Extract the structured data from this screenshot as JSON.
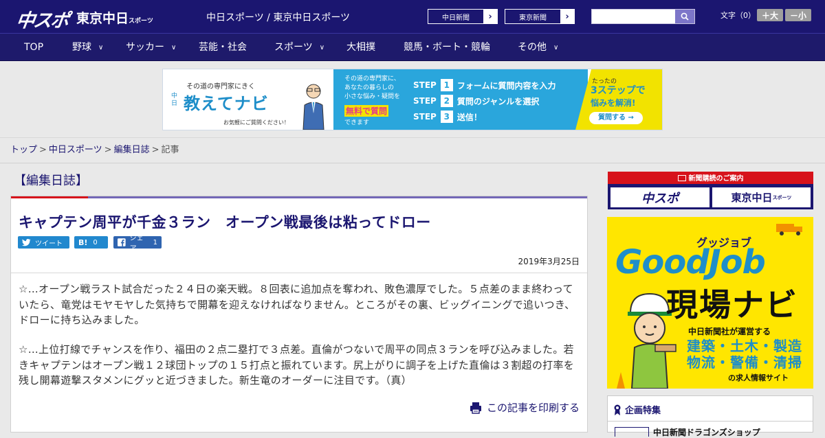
{
  "header": {
    "logo_main": "中スポ",
    "logo_sub": "東京中日",
    "logo_sub_small": "スポーツ",
    "tagline": "中日スポーツ / 東京中日スポーツ",
    "news_links": [
      "中日新聞",
      "東京新聞"
    ],
    "search_placeholder": "",
    "font_size_label": "文字（0）",
    "font_bigger": "＋大",
    "font_smaller": "－小"
  },
  "nav": {
    "items": [
      {
        "label": "TOP"
      },
      {
        "label": "野球"
      },
      {
        "label": "サッカー"
      },
      {
        "label": "芸能・社会"
      },
      {
        "label": "スポーツ"
      },
      {
        "label": "大相撲"
      },
      {
        "label": "競馬・ボート・競輪"
      },
      {
        "label": "その他"
      }
    ]
  },
  "banner": {
    "tag": "その道の専門家にきく",
    "chu": "中日",
    "title": "教えてナビ",
    "note": "お気軽にご質問ください！",
    "desc": [
      "その道の専門家に、",
      "あなたの暮らしの",
      "小さな悩み・疑問を"
    ],
    "free": "無料で質問",
    "desc2": "できます",
    "steps": [
      {
        "no": "1",
        "text": "フォームに質問内容を入力"
      },
      {
        "no": "2",
        "text": "質問のジャンルを選択"
      },
      {
        "no": "3",
        "text": "送信！"
      }
    ],
    "step_label": "STEP",
    "right_small": "たったの",
    "right_big": "3ステップで",
    "right_mid": "悩みを解消!",
    "right_btn": "質問する →"
  },
  "breadcrumb": {
    "items": [
      "トップ",
      "中日スポーツ",
      "編集日誌"
    ],
    "current": "記事",
    "sep": ">"
  },
  "article": {
    "section": "【編集日誌】",
    "title": "キャプテン周平が千金３ラン　オープン戦最後は粘ってドロー",
    "tweet": "ツイート",
    "hatena_label": "B!",
    "hatena_count": "0",
    "share": "シェア",
    "share_count": "1",
    "date": "2019年3月25日",
    "paragraphs": [
      "☆…オープン戦ラスト試合だった２４日の楽天戦。８回表に追加点を奪われ、敗色濃厚でした。５点差のまま終わっていたら、竜党はモヤモヤした気持ちで開幕を迎えなければなりません。ところがその裏、ビッグイニングで追いつき、ドローに持ち込みました。",
      "☆…上位打線でチャンスを作り、福田の２点二塁打で３点差。直倫がつないで周平の同点３ランを呼び込みました。若きキャプテンはオープン戦１２球団トップの１５打点と振れています。尻上がりに調子を上げた直倫は３割超の打率を残し開幕遊撃スタメンにグッと近づきました。新生竜のオーダーに注目です。（真）"
    ],
    "print": "この記事を印刷する"
  },
  "sidebar": {
    "subscribe_title": "新聞購読のご案内",
    "subscribe_btns": [
      "中スポ",
      "東京中日"
    ],
    "subscribe_small": "スポーツ",
    "goodjob": {
      "kicker": "グッジョブ",
      "logo": "GoodJob",
      "title": "現場ナビ",
      "sub": "中日新聞社が運営する",
      "jobs1": "建築・土木・製造",
      "jobs2": "物流・警備・清掃",
      "footer": "の求人情報サイト"
    },
    "feature_title": "企画特集",
    "feature_item": "中日新聞ドラゴンズショップ"
  },
  "colors": {
    "navy": "#1b1670",
    "red": "#d7131b",
    "accent_purple": "#7367b7"
  }
}
